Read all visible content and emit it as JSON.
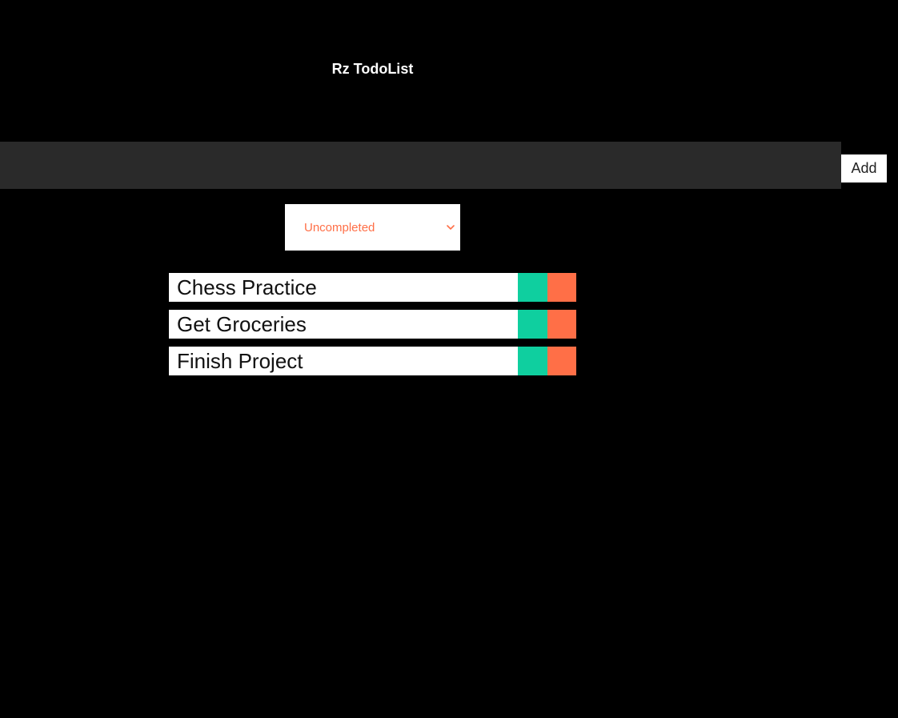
{
  "header": {
    "title": "Rz TodoList"
  },
  "form": {
    "input_value": "",
    "input_placeholder": "",
    "add_label": "Add"
  },
  "filter": {
    "selected": "Uncompleted"
  },
  "todos": [
    {
      "text": "Chess Practice"
    },
    {
      "text": "Get Groceries"
    },
    {
      "text": "Finish Project"
    }
  ],
  "colors": {
    "background": "#000000",
    "input_bar": "#2a2a2a",
    "complete": "#0fcf9f",
    "trash": "#ff6f47",
    "filter_text": "#ff6f47"
  },
  "icons": {
    "filter_dropdown": "chevron-down-icon"
  }
}
